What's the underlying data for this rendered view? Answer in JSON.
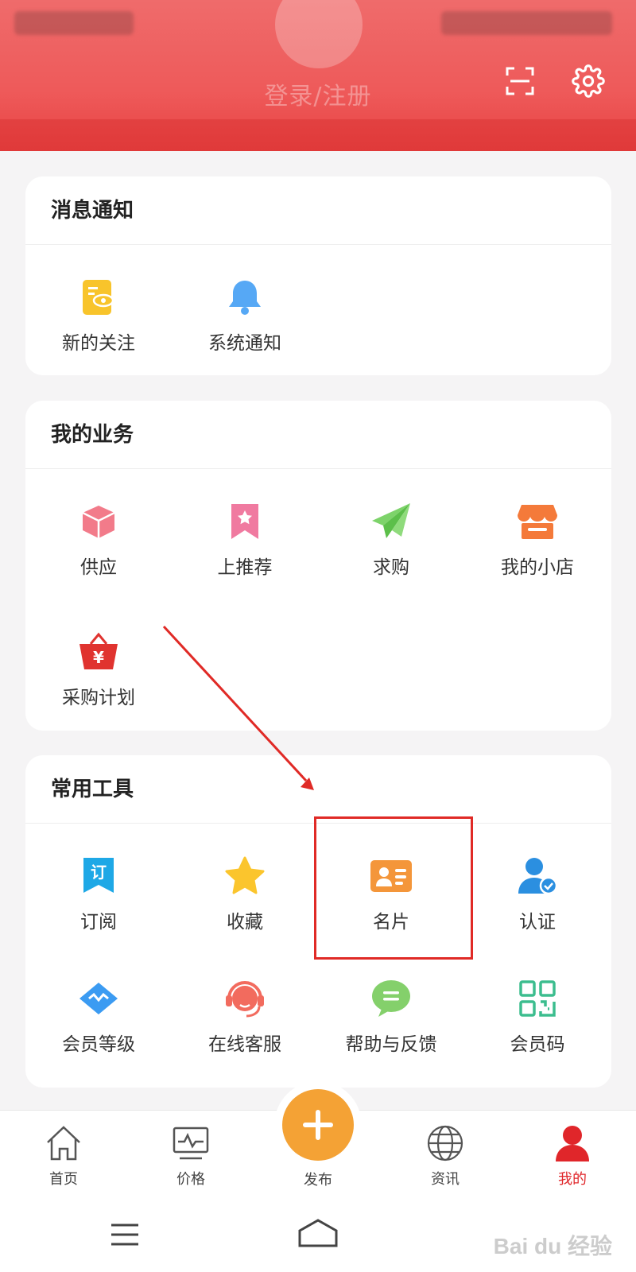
{
  "header": {
    "login_label": "登录/注册",
    "icons": [
      "scan-icon",
      "gear-icon"
    ],
    "accent": "#ee5a5a"
  },
  "messages": {
    "title": "消息通知",
    "items": [
      {
        "label": "新的关注",
        "icon": "new-follow-icon"
      },
      {
        "label": "系统通知",
        "icon": "bell-icon"
      }
    ]
  },
  "business": {
    "title": "我的业务",
    "items": [
      {
        "label": "供应",
        "icon": "box-icon"
      },
      {
        "label": "上推荐",
        "icon": "bookmark-star-icon"
      },
      {
        "label": "求购",
        "icon": "paper-plane-icon"
      },
      {
        "label": "我的小店",
        "icon": "shop-icon"
      },
      {
        "label": "采购计划",
        "icon": "basket-yen-icon"
      }
    ]
  },
  "tools": {
    "title": "常用工具",
    "items": [
      {
        "label": "订阅",
        "icon": "subscribe-icon",
        "glyph": "订"
      },
      {
        "label": "收藏",
        "icon": "star-icon"
      },
      {
        "label": "名片",
        "icon": "business-card-icon"
      },
      {
        "label": "认证",
        "icon": "verified-user-icon"
      },
      {
        "label": "会员等级",
        "icon": "diamond-icon"
      },
      {
        "label": "在线客服",
        "icon": "headset-icon"
      },
      {
        "label": "帮助与反馈",
        "icon": "chat-bubble-icon"
      },
      {
        "label": "会员码",
        "icon": "qr-code-icon"
      }
    ]
  },
  "tabbar": {
    "tabs": [
      {
        "label": "首页",
        "icon": "home-icon"
      },
      {
        "label": "价格",
        "icon": "price-chart-icon"
      },
      {
        "label": "发布",
        "icon": "plus-icon"
      },
      {
        "label": "资讯",
        "icon": "globe-icon"
      },
      {
        "label": "我的",
        "icon": "user-icon",
        "active": true
      }
    ],
    "active_color": "#e0262a",
    "fab_color": "#f4a235"
  },
  "watermark": "Bai du 经验"
}
